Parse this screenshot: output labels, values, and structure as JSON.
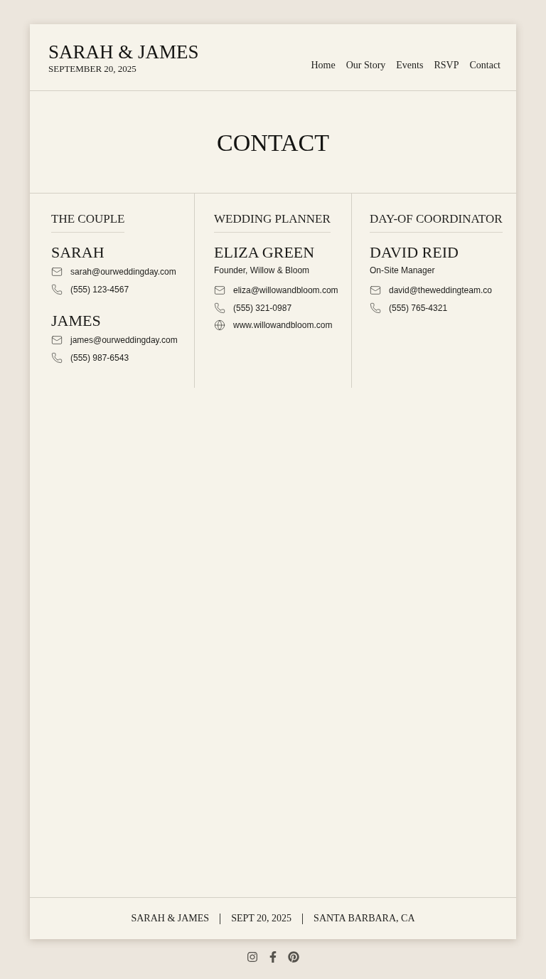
{
  "header": {
    "title": "SARAH & JAMES",
    "date": "SEPTEMBER 20, 2025",
    "nav": [
      "Home",
      "Our Story",
      "Events",
      "RSVP",
      "Contact"
    ]
  },
  "page_title": "CONTACT",
  "columns": [
    {
      "heading": "THE COUPLE",
      "people": [
        {
          "name": "SARAH",
          "contacts": [
            {
              "kind": "email",
              "text": "sarah@ourweddingday.com"
            },
            {
              "kind": "phone",
              "text": "(555) 123-4567"
            }
          ]
        },
        {
          "name": "JAMES",
          "contacts": [
            {
              "kind": "email",
              "text": "james@ourweddingday.com"
            },
            {
              "kind": "phone",
              "text": "(555) 987-6543"
            }
          ]
        }
      ]
    },
    {
      "heading": "WEDDING PLANNER",
      "people": [
        {
          "name": "ELIZA GREEN",
          "role": "Founder, Willow & Bloom",
          "contacts": [
            {
              "kind": "email",
              "text": "eliza@willowandbloom.com"
            },
            {
              "kind": "phone",
              "text": "(555) 321-0987"
            },
            {
              "kind": "web",
              "text": "www.willowandbloom.com"
            }
          ]
        }
      ]
    },
    {
      "heading": "DAY-OF COORDINATOR",
      "people": [
        {
          "name": "DAVID REID",
          "role": "On-Site Manager",
          "contacts": [
            {
              "kind": "email",
              "text": "david@theweddingteam.co"
            },
            {
              "kind": "phone",
              "text": "(555) 765-4321"
            }
          ]
        }
      ]
    }
  ],
  "footer": {
    "items": [
      "SARAH & JAMES",
      "SEPT 20, 2025",
      "SANTA BARBARA, CA"
    ]
  }
}
